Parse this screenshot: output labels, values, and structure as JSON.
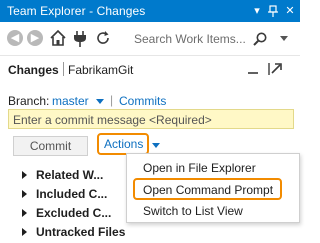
{
  "window": {
    "title": "Team Explorer - Changes",
    "dropdown_glyph": "▾",
    "pin_glyph": "⊣",
    "close_glyph": "✕"
  },
  "toolbar": {
    "back_icon": "back-arrow-icon",
    "forward_icon": "forward-arrow-icon",
    "home_icon": "home-icon",
    "connect_icon": "plug-icon",
    "refresh_icon": "refresh-icon",
    "search_placeholder": "Search Work Items...",
    "search_icon": "search-icon"
  },
  "page": {
    "title": "Changes",
    "repo": "FabrikamGit"
  },
  "branch": {
    "label": "Branch:",
    "name": "master",
    "pipe": "|",
    "commits_link": "Commits"
  },
  "commit": {
    "message_placeholder": "Enter a commit message <Required>",
    "commit_button": "Commit",
    "actions_label": "Actions"
  },
  "sections": [
    "Related W...",
    "Included C...",
    "Excluded C...",
    "Untracked Files"
  ],
  "actions_menu": [
    "Open in File Explorer",
    "Open Command Prompt",
    "Switch to List View"
  ],
  "colors": {
    "title_bar": "#007acc",
    "link": "#0e70c0",
    "callout": "#f28b00",
    "commit_field": "#fff8c6"
  }
}
